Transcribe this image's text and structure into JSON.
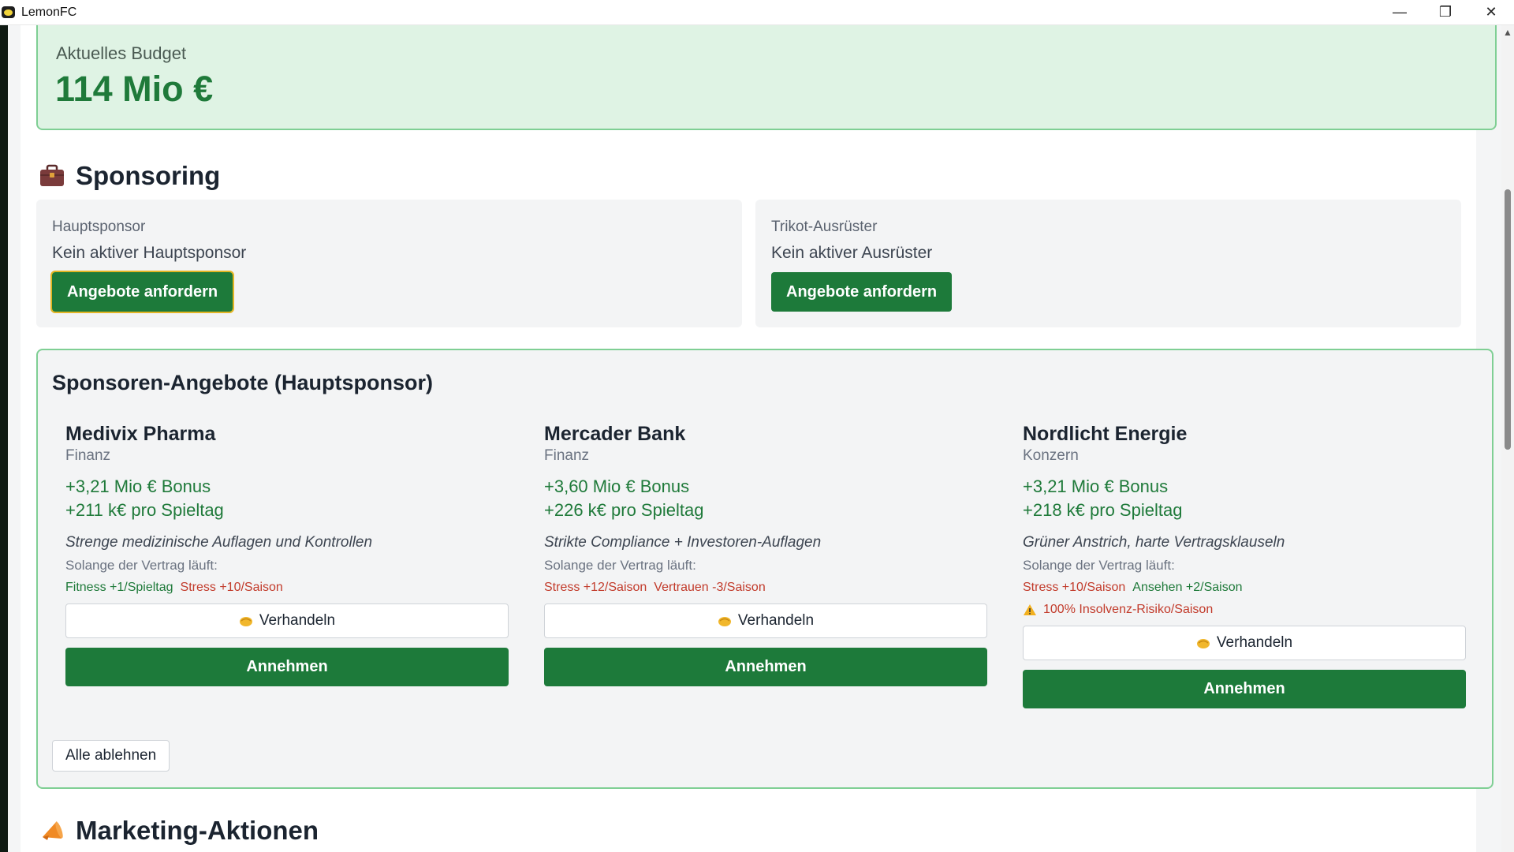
{
  "window": {
    "title": "LemonFC",
    "minimize_glyph": "—",
    "maximize_glyph": "❐",
    "close_glyph": "✕"
  },
  "budget": {
    "label": "Aktuelles Budget",
    "value": "114 Mio €"
  },
  "sponsoring": {
    "title": "Sponsoring",
    "icon": "briefcase-icon",
    "cards": [
      {
        "label": "Hauptsponsor",
        "status": "Kein aktiver Hauptsponsor",
        "button": "Angebote anfordern"
      },
      {
        "label": "Trikot-Ausrüster",
        "status": "Kein aktiver Ausrüster",
        "button": "Angebote anfordern"
      }
    ]
  },
  "offers": {
    "title": "Sponsoren-Angebote (Hauptsponsor)",
    "while_label": "Solange der Vertrag läuft:",
    "negotiate_label": "Verhandeln",
    "accept_label": "Annehmen",
    "reject_all_label": "Alle ablehnen",
    "items": [
      {
        "name": "Medivix Pharma",
        "category": "Finanz",
        "bonus": "+3,21 Mio € Bonus",
        "per_match": "+211 k€ pro Spieltag",
        "description": "Strenge medizinische Auflagen und Kontrollen",
        "effect_1": "Fitness +1/Spieltag",
        "effect_2": "Stress +10/Saison"
      },
      {
        "name": "Mercader Bank",
        "category": "Finanz",
        "bonus": "+3,60 Mio € Bonus",
        "per_match": "+226 k€ pro Spieltag",
        "description": "Strikte Compliance + Investoren-Auflagen",
        "effect_1": "Stress +12/Saison",
        "effect_2": "Vertrauen -3/Saison"
      },
      {
        "name": "Nordlicht Energie",
        "category": "Konzern",
        "bonus": "+3,21 Mio € Bonus",
        "per_match": "+218 k€ pro Spieltag",
        "description": "Grüner Anstrich, harte Vertragsklauseln",
        "effect_1": "Stress +10/Saison",
        "effect_2": "Ansehen +2/Saison",
        "warning": "100% Insolvenz-Risiko/Saison"
      }
    ]
  },
  "marketing": {
    "title": "Marketing-Aktionen",
    "icon": "megaphone-icon"
  },
  "colors": {
    "accent_green": "#1d7a3a",
    "budget_bg": "#dff3e4",
    "positive": "#1f7a3a",
    "negative": "#c23b2b",
    "focus_ring": "#e3b524"
  }
}
